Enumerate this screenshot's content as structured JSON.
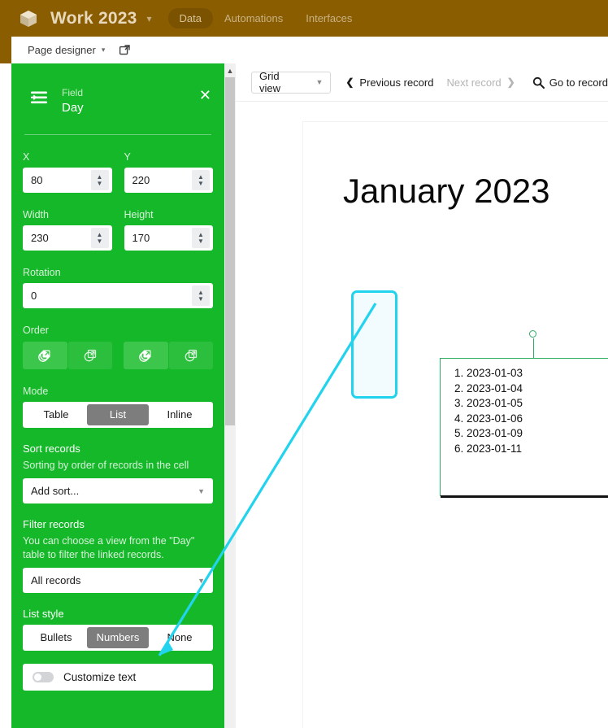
{
  "topbar": {
    "logo_icon": "cube-icon",
    "app_title": "Work 2023",
    "title_caret_icon": "chevron-down-icon",
    "tabs": [
      {
        "label": "Data",
        "active": true
      },
      {
        "label": "Automations",
        "active": false
      },
      {
        "label": "Interfaces",
        "active": false
      }
    ],
    "bg_color": "#8a5d00"
  },
  "subbar": {
    "label": "Page designer",
    "caret_icon": "chevron-down-icon",
    "external_link_icon": "external-link-icon"
  },
  "panel": {
    "bg_color": "#15b829",
    "field_icon": "field-link-icon",
    "header_label": "Field",
    "header_value": "Day",
    "close_icon": "close-icon",
    "x": {
      "label": "X",
      "value": "80"
    },
    "y": {
      "label": "Y",
      "value": "220"
    },
    "width": {
      "label": "Width",
      "value": "230"
    },
    "height": {
      "label": "Height",
      "value": "170"
    },
    "rotation": {
      "label": "Rotation",
      "value": "0"
    },
    "order": {
      "label": "Order",
      "buttons": [
        {
          "icon": "bring-to-front-icon"
        },
        {
          "icon": "bring-forward-icon"
        },
        {
          "icon": "send-to-back-icon"
        },
        {
          "icon": "send-backward-icon"
        }
      ]
    },
    "mode": {
      "label": "Mode",
      "options": [
        "Table",
        "List",
        "Inline"
      ],
      "selected": "List"
    },
    "sort": {
      "label": "Sort records",
      "help": "Sorting by order of records in the cell",
      "select_value": "Add sort...",
      "caret_icon": "chevron-down-icon"
    },
    "filter": {
      "label": "Filter records",
      "help": "You can choose a view from the \"Day\" table to filter the linked records.",
      "select_value": "All records",
      "caret_icon": "chevron-down-icon"
    },
    "list_style": {
      "label": "List style",
      "options": [
        "Bullets",
        "Numbers",
        "None"
      ],
      "selected": "Numbers"
    },
    "customize_text": {
      "label": "Customize text",
      "enabled": false
    },
    "scrollbar": {
      "up_arrow_icon": "chevron-up-icon"
    }
  },
  "main": {
    "toolbar": {
      "view_select": "Grid view",
      "view_caret_icon": "chevron-down-icon",
      "previous_record": "Previous record",
      "previous_icon": "chevron-left-icon",
      "next_record": "Next record",
      "next_icon": "chevron-right-icon",
      "search_icon": "search-icon",
      "go_to_record": "Go to record"
    },
    "canvas": {
      "page_title": "January 2023",
      "selected_element": {
        "type": "list",
        "style": "numbers",
        "items": [
          "2023-01-03",
          "2023-01-04",
          "2023-01-05",
          "2023-01-06",
          "2023-01-09",
          "2023-01-11"
        ],
        "selection_color": "#2bab63",
        "rotation_handle_icon": "rotate-handle-icon",
        "resize_handle_icon": "resize-handle-icon"
      }
    }
  },
  "annotation": {
    "highlight_color": "#22d3ee",
    "arrow_color": "#22d3ee",
    "describes": "numbers-list-markers"
  }
}
